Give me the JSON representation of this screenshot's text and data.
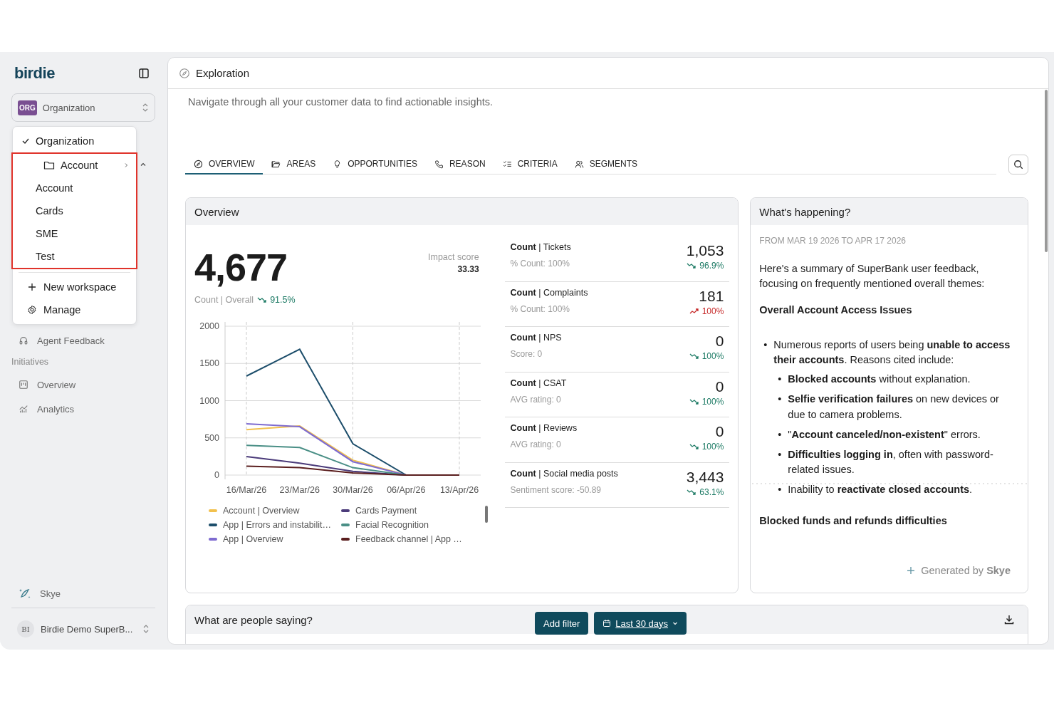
{
  "sidebar": {
    "logo": "birdie",
    "org_selector": {
      "badge": "ORG",
      "label": "Organization"
    },
    "nav_items": [
      {
        "label": "Agent Feedback"
      }
    ],
    "section_label": "Initiatives",
    "initiative_items": [
      {
        "kind": "board",
        "label": "Overview"
      },
      {
        "kind": "analytics",
        "label": "Analytics"
      }
    ],
    "assistant": {
      "label": "Skye"
    },
    "user": {
      "initials": "BI",
      "name": "Birdie Demo SuperB..."
    }
  },
  "org_menu": {
    "top_items": [
      {
        "label": "Organization",
        "checked": true
      }
    ],
    "workspace_group_highlighted": true,
    "workspace_items": [
      {
        "kind": "folder",
        "label": "Account",
        "checked": false,
        "expanded": true
      },
      {
        "kind": "option",
        "label": "Account",
        "checked": false
      },
      {
        "kind": "option",
        "label": "Cards",
        "checked": false
      },
      {
        "kind": "option",
        "label": "SME",
        "checked": false
      },
      {
        "kind": "option",
        "label": "Test",
        "checked": false
      }
    ],
    "actions": [
      {
        "kind": "add",
        "label": "New workspace"
      },
      {
        "kind": "manage",
        "label": "Manage"
      }
    ]
  },
  "header": {
    "title": "Exploration"
  },
  "subtitle": "Navigate through all your customer data to find actionable insights.",
  "tabs": [
    {
      "kind": "overview",
      "label": "OVERVIEW",
      "selected": true
    },
    {
      "kind": "areas",
      "label": "AREAS",
      "selected": false
    },
    {
      "kind": "opportunities",
      "label": "OPPORTUNITIES",
      "selected": false
    },
    {
      "kind": "reason",
      "label": "REASON",
      "selected": false
    },
    {
      "kind": "criteria",
      "label": "CRITERIA",
      "selected": false
    },
    {
      "kind": "segments",
      "label": "SEGMENTS",
      "selected": false
    }
  ],
  "overview": {
    "title": "Overview",
    "total": "4,677",
    "total_label": "Count | Overall",
    "total_delta": {
      "text": "91.5%",
      "rising": false
    },
    "impact_label": "Impact score",
    "impact_value": "33.33",
    "chart_data": {
      "type": "line",
      "grid": true,
      "categories": [
        "16/Mar/26",
        "23/Mar/26",
        "30/Mar/26",
        "06/Apr/26",
        "13/Apr/26"
      ],
      "ylim": [
        0,
        2000
      ],
      "yticks": [
        0,
        500,
        1000,
        1500,
        2000
      ],
      "series": [
        {
          "name": "Account | Overview",
          "color": "#f2c14e",
          "values": [
            610,
            660,
            200,
            0,
            0
          ]
        },
        {
          "name": "App | Errors and instabilit…",
          "color": "#1d4e6b",
          "values": [
            1330,
            1690,
            420,
            0,
            0
          ]
        },
        {
          "name": "App | Overview",
          "color": "#7e6bd0",
          "values": [
            690,
            650,
            180,
            0,
            0
          ]
        },
        {
          "name": "Cards Payment",
          "color": "#4b3b7a",
          "values": [
            250,
            160,
            50,
            0,
            0
          ]
        },
        {
          "name": "Facial Recognition",
          "color": "#4a8f86",
          "values": [
            400,
            370,
            100,
            0,
            0
          ]
        },
        {
          "name": "Feedback channel | App …",
          "color": "#5a1e1e",
          "values": [
            120,
            100,
            30,
            0,
            0
          ]
        }
      ]
    },
    "metrics": [
      {
        "label": "**Count** | Tickets",
        "detail": "% Count: 100%",
        "value": "1,053",
        "delta": "96.9%",
        "rising": false
      },
      {
        "label": "**Count** | Complaints",
        "detail": "% Count: 100%",
        "value": "181",
        "delta": "100%",
        "rising": true
      },
      {
        "label": "**Count** | NPS",
        "detail": "Score: 0",
        "value": "0",
        "delta": "100%",
        "rising": false
      },
      {
        "label": "**Count** | CSAT",
        "detail": "AVG rating: 0",
        "value": "0",
        "delta": "100%",
        "rising": false
      },
      {
        "label": "**Count** | Reviews",
        "detail": "AVG rating: 0",
        "value": "0",
        "delta": "100%",
        "rising": false
      },
      {
        "label": "**Count** | Social media posts",
        "detail": "Sentiment score: -50.89",
        "value": "3,443",
        "delta": "63.1%",
        "rising": false
      }
    ]
  },
  "happening": {
    "title": "What's happening?",
    "range": "FROM MAR 19 2026 TO APR 17 2026",
    "intro": "Here's a summary of SuperBank user feedback, focusing on frequently mentioned overall themes:",
    "sections": [
      {
        "heading": "Overall Account Access Issues",
        "bullets": [
          {
            "marker": "•",
            "text": "Numerous reports of users being **unable to access their accounts**. Reasons cited include:",
            "children": [
              {
                "marker": "•",
                "text": "**Blocked accounts** without explanation."
              },
              {
                "marker": "•",
                "text": "**Selfie verification failures** on new devices or due to camera problems."
              },
              {
                "marker": "•",
                "text": "\"**Account canceled/non-existent**\" errors."
              },
              {
                "marker": "•",
                "text": "**Difficulties logging in**, often with password-related issues."
              },
              {
                "marker": "•",
                "text": "Inability to **reactivate closed accounts**."
              }
            ]
          }
        ]
      },
      {
        "heading": "Blocked funds and refunds difficulties"
      }
    ],
    "footer": "Generated by **Skye**"
  },
  "feedback": {
    "title": "What are people saying?",
    "filter_button": "Add filter",
    "date_button": "Last 30 days"
  }
}
